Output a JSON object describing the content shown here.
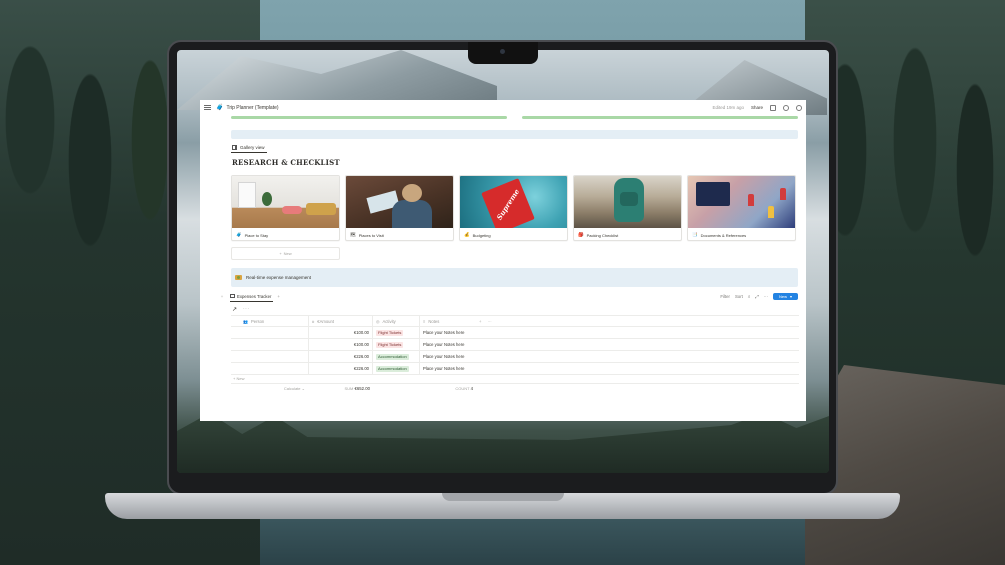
{
  "window": {
    "title": "Trip Planner (Template)",
    "edited": "Edited 19m ago",
    "share": "Share"
  },
  "gallery": {
    "view_label": "Gallery view",
    "section_title": "RESEARCH & CHECKLIST",
    "new_label": "New",
    "cards": [
      {
        "label": "Place to Stay",
        "icon": "luggage-icon"
      },
      {
        "label": "Places to Visit",
        "icon": "map-icon"
      },
      {
        "label": "Budgeting",
        "icon": "money-bag-icon"
      },
      {
        "label": "Packing Checklist",
        "icon": "backpack-icon"
      },
      {
        "label": "Documents & References",
        "icon": "document-icon"
      }
    ]
  },
  "callout": {
    "text": "Real-time expense management"
  },
  "database": {
    "tab_label": "Expenses Tracker",
    "tools": {
      "filter": "Filter",
      "sort": "Sort",
      "new": "New"
    },
    "columns": [
      "Person",
      "€Amount",
      "Activity",
      "Notes"
    ],
    "rows": [
      {
        "person": "",
        "amount": "€100.00",
        "activity": "Flight Tickets",
        "activity_color": "red",
        "notes": "Place your Notes here"
      },
      {
        "person": "",
        "amount": "€100.00",
        "activity": "Flight Tickets",
        "activity_color": "red",
        "notes": "Place your Notes here"
      },
      {
        "person": "",
        "amount": "€226.00",
        "activity": "Accommodation",
        "activity_color": "green",
        "notes": "Place your Notes here"
      },
      {
        "person": "",
        "amount": "€226.00",
        "activity": "Accommodation",
        "activity_color": "green",
        "notes": "Place your Notes here"
      }
    ],
    "new_row": "New",
    "calculate": "Calculate",
    "sum_label": "SUM",
    "sum_value": "€652.00",
    "count_label": "COUNT",
    "count_value": "4"
  },
  "colors": {
    "accent": "#2383e2",
    "progress": "#a9d8a6",
    "callout_bg": "#e4eef5"
  }
}
